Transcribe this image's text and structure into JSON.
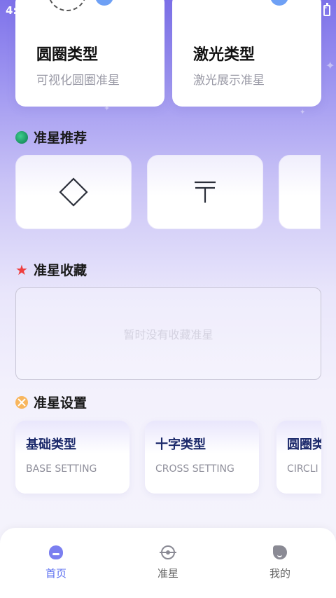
{
  "status_bar": {
    "time": "4:"
  },
  "crosshair_types": [
    {
      "title": "圆圈类型",
      "subtitle": "可视化圆圈准星"
    },
    {
      "title": "激光类型",
      "subtitle": "激光展示准星"
    }
  ],
  "recommend": {
    "title": "准星推荐",
    "items": [
      {
        "icon": "diamond-icon"
      },
      {
        "icon": "t-bar-icon"
      },
      {
        "icon": "partial-icon"
      }
    ]
  },
  "favorites": {
    "title": "准星收藏",
    "empty_text": "暂时没有收藏准星"
  },
  "settings": {
    "title": "准星设置",
    "items": [
      {
        "title": "基础类型",
        "subtitle": "BASE SETTING"
      },
      {
        "title": "十字类型",
        "subtitle": "CROSS SETTING"
      },
      {
        "title": "圆圈类",
        "subtitle": "CIRCLI"
      }
    ]
  },
  "tab_bar": {
    "tabs": [
      {
        "label": "首页",
        "icon": "home-icon",
        "active": true
      },
      {
        "label": "准星",
        "icon": "crosshair-icon",
        "active": false
      },
      {
        "label": "我的",
        "icon": "profile-icon",
        "active": false
      }
    ]
  },
  "colors": {
    "accent": "#5b6ff0",
    "background_top": "#7e72ea",
    "favorite_star": "#ef3e3e"
  }
}
